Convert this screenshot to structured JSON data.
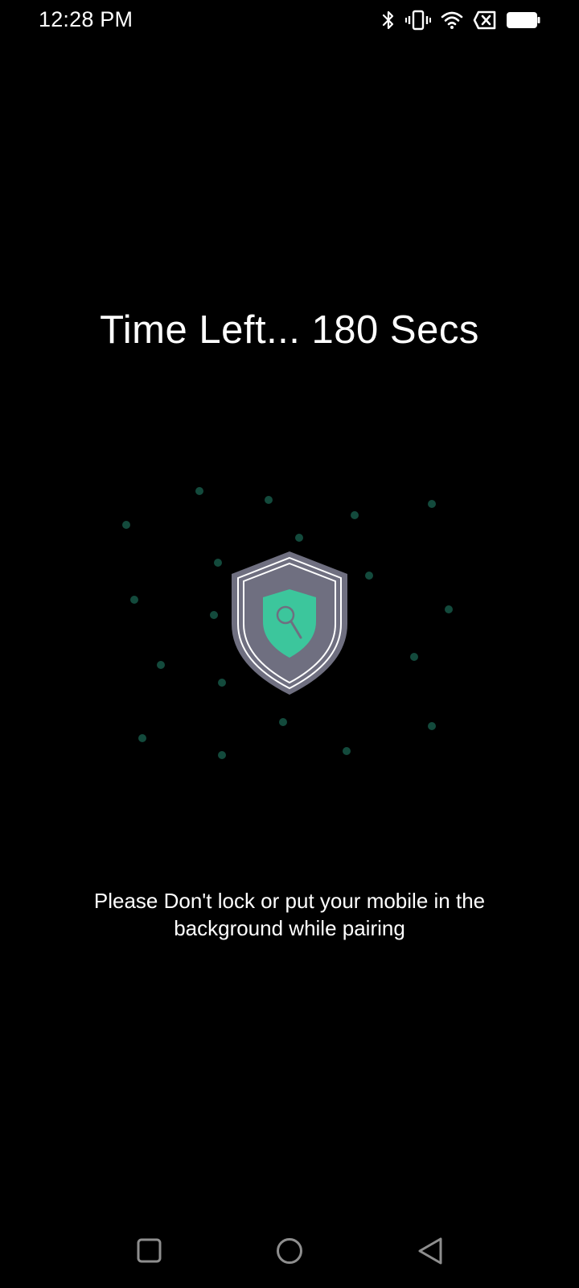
{
  "status_bar": {
    "time": "12:28 PM",
    "icons": [
      "bluetooth-icon",
      "vibrate-icon",
      "wifi-icon",
      "no-sim-icon",
      "battery-icon"
    ]
  },
  "screen": {
    "timer_text": "Time Left... 180 Secs",
    "note_text": "Please Don't lock or put your mobile in the background while pairing",
    "icon": "shield-search-icon"
  },
  "colors": {
    "background": "#000000",
    "text": "#ffffff",
    "shield_outer": "#6f6f80",
    "shield_inner": "#3cc69c",
    "scan_dots": "#134a3c",
    "nav_icons": "#8e8e8e"
  },
  "nav_bar": {
    "buttons": [
      "recents-button",
      "home-button",
      "back-button"
    ]
  }
}
